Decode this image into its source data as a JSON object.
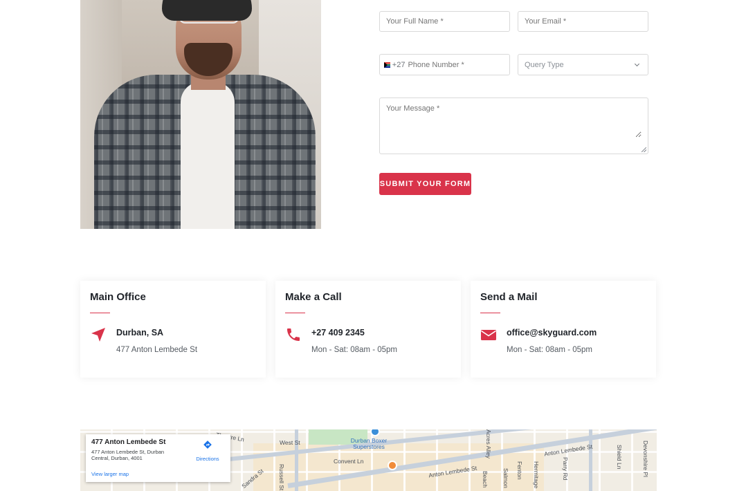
{
  "form": {
    "name_placeholder": "Your Full Name *",
    "email_placeholder": "Your Email *",
    "phone_code": "+27",
    "phone_placeholder": "Phone Number *",
    "query_placeholder": "Query Type",
    "message_placeholder": "Your Message *",
    "submit_label": "SUBMIT YOUR FORM"
  },
  "cards": [
    {
      "title": "Main Office",
      "main": "Durban, SA",
      "sub": "477 Anton Lembede St",
      "icon": "location-arrow-icon"
    },
    {
      "title": "Make a Call",
      "main": "+27 409 2345",
      "sub": "Mon - Sat: 08am - 05pm",
      "icon": "phone-icon"
    },
    {
      "title": "Send a Mail",
      "main": "office@skyguard.com",
      "sub": "Mon - Sat: 08am - 05pm",
      "icon": "envelope-icon"
    }
  ],
  "map": {
    "place_title": "477 Anton Lembede St",
    "place_address": "477 Anton Lembede St, Durban Central, Durban, 4001",
    "directions_label": "Directions",
    "larger_map_label": "View larger map",
    "street_labels": [
      "West St",
      "Durban Boxer Superstores",
      "Convent Ln",
      "Anton Lembede St",
      "Anton Lembede St",
      "Russell St",
      "Sandra St",
      "Beach",
      "Salmon",
      "Fenton",
      "Hermitage",
      "Parry Rd",
      "Devonshire Pl",
      "Shield Ln",
      "Acres Alley",
      "Theatre Ln"
    ]
  },
  "colors": {
    "accent": "#d9334a",
    "text_dark": "#1f2329"
  }
}
